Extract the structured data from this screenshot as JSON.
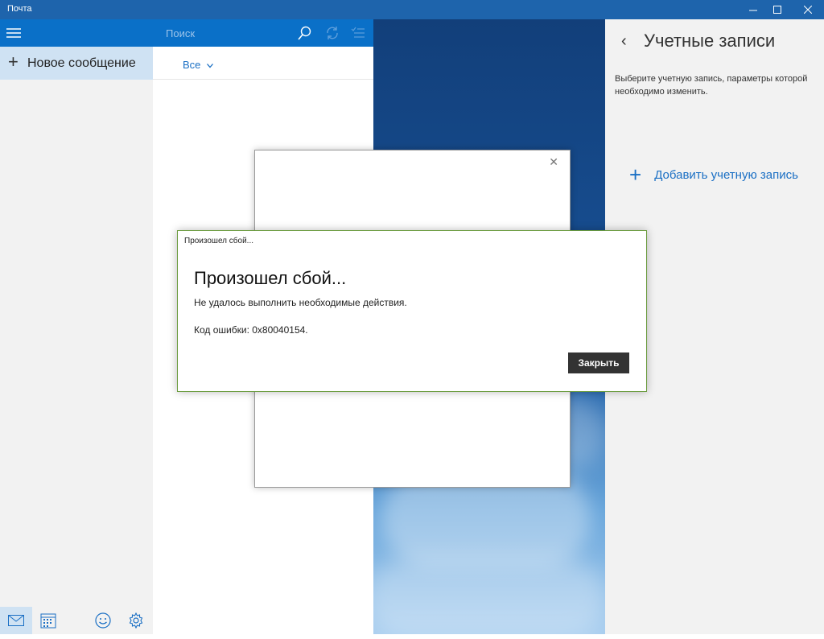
{
  "window": {
    "title": "Почта"
  },
  "nav": {
    "new_message": "Новое сообщение"
  },
  "list": {
    "search_placeholder": "Поиск",
    "filter": "Все"
  },
  "accounts": {
    "title": "Учетные записи",
    "description": "Выберите учетную запись, параметры которой необходимо изменить.",
    "add_account": "Добавить учетную запись"
  },
  "error_dialog": {
    "caption": "Произошел сбой...",
    "title": "Произошел сбой...",
    "message": "Не удалось выполнить необходимые действия.",
    "code": "Код ошибки: 0x80040154.",
    "close_button": "Закрыть"
  },
  "colors": {
    "titlebar": "#1e64ac",
    "accent": "#0a70c8",
    "link": "#1a6fc4",
    "selected": "#cfe2f3",
    "dialog_border": "#6a9b3d"
  },
  "icons": {
    "hamburger": "hamburger-icon",
    "search": "search-icon",
    "sync": "sync-icon",
    "select": "select-mode-icon",
    "mail": "mail-icon",
    "calendar": "calendar-icon",
    "feedback": "smiley-icon",
    "settings": "gear-icon"
  }
}
